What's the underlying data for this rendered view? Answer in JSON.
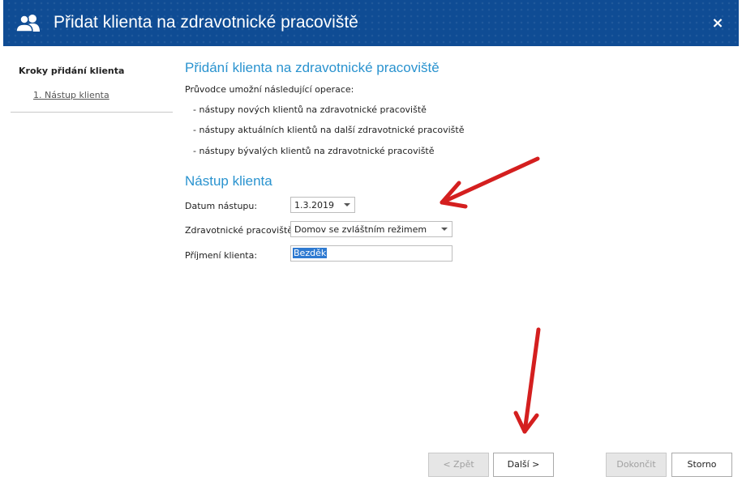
{
  "window": {
    "title": "Přidat klienta na zdravotnické pracoviště",
    "close_label": "×"
  },
  "sidebar": {
    "title": "Kroky přidání klienta",
    "steps": [
      {
        "label": "1. Nástup klienta"
      }
    ]
  },
  "intro": {
    "heading": "Přidání klienta na zdravotnické pracoviště",
    "description": "Průvodce umožní následující operace:",
    "operations": [
      "- nástupy nových klientů na zdravotnické pracoviště",
      "- nástupy aktuálních klientů na další zdravotnické pracoviště",
      "- nástupy bývalých klientů na zdravotnické pracoviště"
    ]
  },
  "form": {
    "heading": "Nástup klienta",
    "date": {
      "label": "Datum nástupu:",
      "value": "1.3.2019"
    },
    "workplace": {
      "label": "Zdravotnické pracoviště:",
      "value": "Domov se zvláštním režimem"
    },
    "surname": {
      "label": "Příjmení klienta:",
      "value": "Bezděk"
    }
  },
  "buttons": {
    "back": "< Zpět",
    "next": "Další >",
    "finish": "Dokončit",
    "cancel": "Storno"
  },
  "colors": {
    "titlebar": "#0f4c94",
    "heading": "#2a93cf",
    "annotation_arrow": "#d41f1f",
    "selection": "#2e7ad1"
  },
  "icons": {
    "title": "users-icon",
    "close": "close-icon",
    "dropdown": "chevron-down-icon"
  }
}
